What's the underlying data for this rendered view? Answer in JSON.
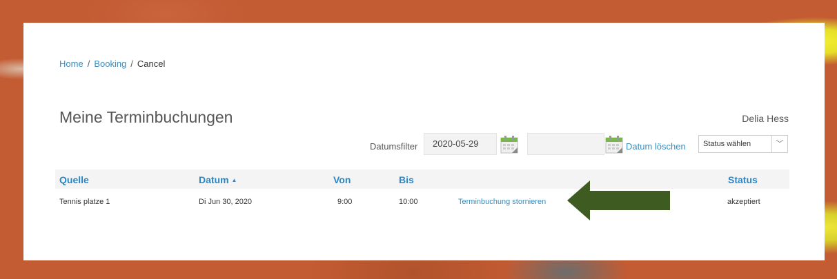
{
  "breadcrumb": {
    "home": "Home",
    "booking": "Booking",
    "current": "Cancel",
    "separator": "/"
  },
  "page_title": "Meine Terminbuchungen",
  "user_name": "Delia Hess",
  "filter": {
    "label": "Datumsfilter",
    "from_value": "2020-05-29",
    "to_value": "",
    "clear_label": "Datum löschen",
    "status_select": "Status wählen"
  },
  "table": {
    "headers": {
      "source": "Quelle",
      "date": "Datum",
      "from": "Von",
      "to": "Bis",
      "status": "Status"
    },
    "sort_indicator": "▲",
    "rows": [
      {
        "source": "Tennis platze 1",
        "date": "Di Jun 30, 2020",
        "from": "9:00",
        "to": "10:00",
        "action": "Terminbuchung stornieren",
        "status": "akzeptiert"
      }
    ]
  },
  "colors": {
    "link": "#3c8dbc",
    "header": "#2a86c4",
    "arrow": "#3e5b21"
  },
  "icons": {
    "calendar": "calendar-icon",
    "chevron": "chevron-down-icon",
    "arrow": "left-arrow-icon"
  }
}
